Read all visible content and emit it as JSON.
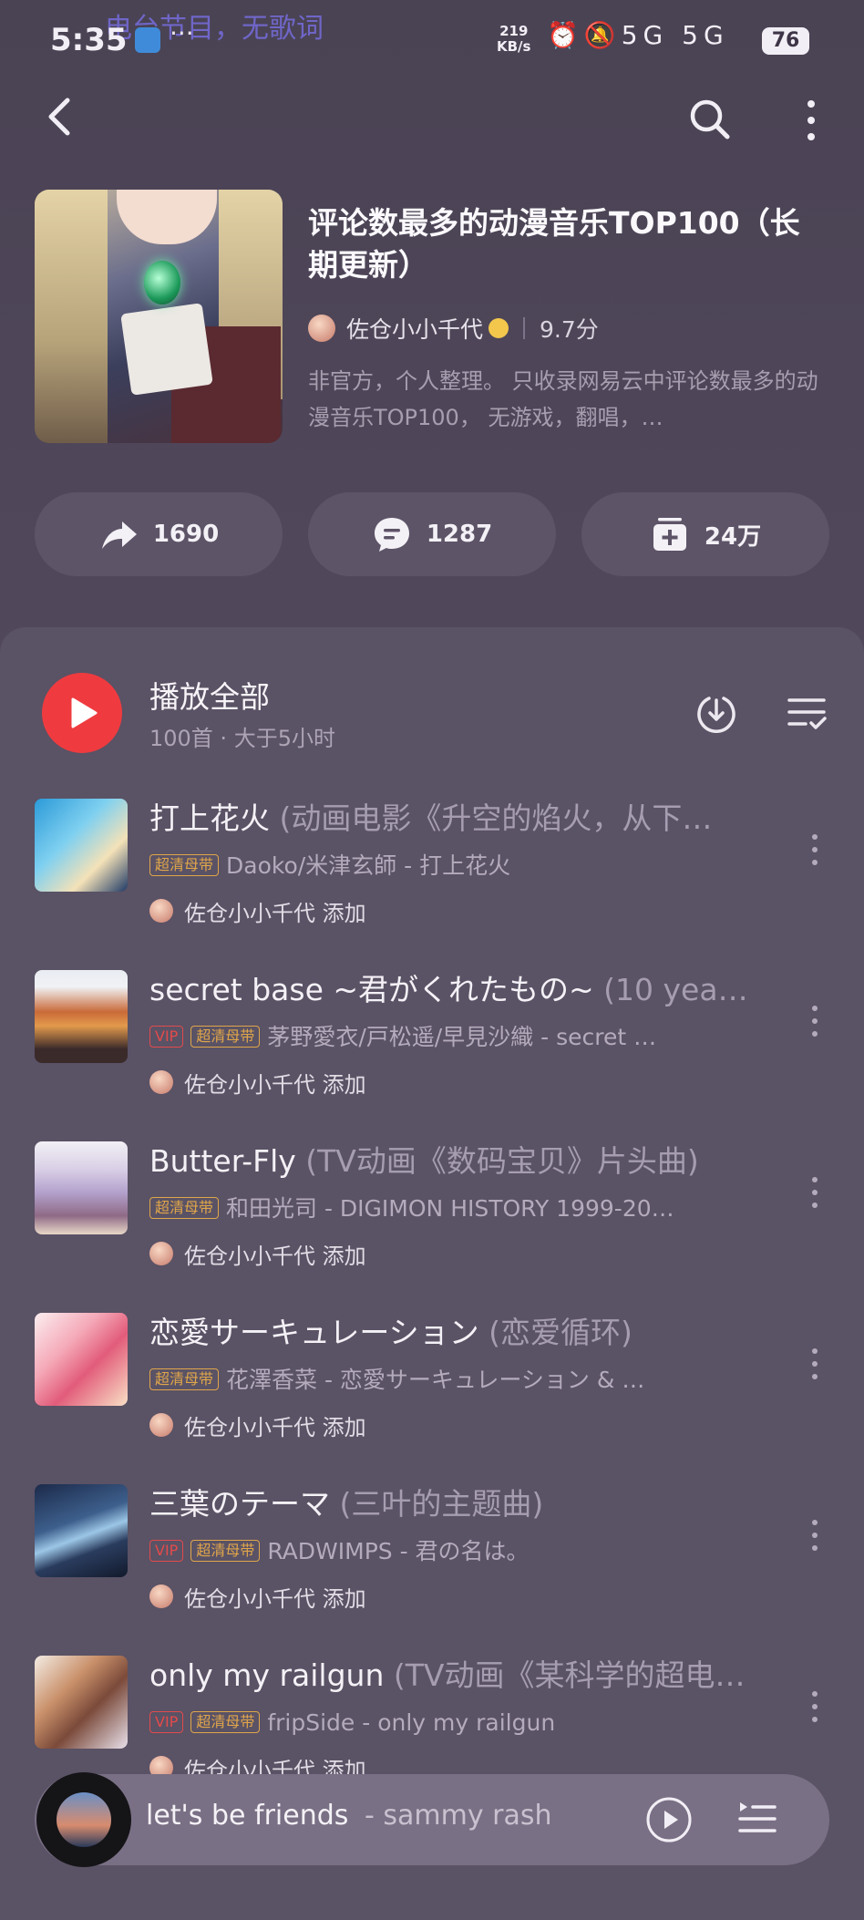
{
  "status_bar": {
    "time": "5:35",
    "overlay_text": "电台节目，无歌词",
    "net_rate_top": "219",
    "net_rate_bottom": "KB/s",
    "signal_text": "5G 5G",
    "battery": "76"
  },
  "playlist": {
    "title": "评论数最多的动漫音乐TOP100（长期更新）",
    "creator": "佐仓小小千代",
    "score": "9.7分",
    "description": "非官方，个人整理。 只收录网易云中评论数最多的动漫音乐TOP100， 无游戏，翻唱，…",
    "actions": {
      "share_count": "1690",
      "comment_count": "1287",
      "collect_count": "24万"
    }
  },
  "play_all": {
    "label": "播放全部",
    "sub": "100首 · 大于5小时"
  },
  "songs": [
    {
      "title": "打上花火",
      "subtitle": " (动画电影《升空的焰火，从下…",
      "vip": "",
      "hq": "超清母带",
      "artist_album": "Daoko/米津玄師 - 打上花火",
      "added_by": "佐仓小小千代 添加"
    },
    {
      "title": "secret base ~君がくれたもの~",
      "subtitle": " (10 yea…",
      "vip": "VIP",
      "hq": "超清母带",
      "artist_album": "茅野愛衣/戸松遥/早見沙織 - secret …",
      "added_by": "佐仓小小千代 添加"
    },
    {
      "title": "Butter-Fly",
      "subtitle": " (TV动画《数码宝贝》片头曲)",
      "vip": "",
      "hq": "超清母带",
      "artist_album": "和田光司 - DIGIMON HISTORY 1999-20…",
      "added_by": "佐仓小小千代 添加"
    },
    {
      "title": "恋愛サーキュレーション",
      "subtitle": " (恋爱循环)",
      "vip": "",
      "hq": "超清母带",
      "artist_album": "花澤香菜 - 恋愛サーキュレーション & …",
      "added_by": "佐仓小小千代 添加"
    },
    {
      "title": "三葉のテーマ",
      "subtitle": " (三叶的主题曲)",
      "vip": "VIP",
      "hq": "超清母带",
      "artist_album": "RADWIMPS - 君の名は。",
      "added_by": "佐仓小小千代 添加"
    },
    {
      "title": "only my railgun",
      "subtitle": " (TV动画《某科学的超电…",
      "vip": "VIP",
      "hq": "超清母带",
      "artist_album": "fripSide - only my railgun",
      "added_by": "佐仓小小千代 添加"
    }
  ],
  "now_playing": {
    "title": "let's be friends",
    "artist": "- sammy rash"
  },
  "icons": {
    "back": "back-arrow-icon",
    "search": "search-icon",
    "more": "more-vertical-icon",
    "share": "share-icon",
    "comment": "comment-icon",
    "collect": "collect-icon",
    "play": "play-icon",
    "download": "download-icon",
    "multi_select": "multi-select-icon",
    "kebab": "kebab-icon",
    "playlist": "playlist-icon"
  },
  "colors": {
    "accent_red": "#ef3b3f",
    "hq_tag": "#e0a64a",
    "vip_tag": "#e24b4b"
  }
}
